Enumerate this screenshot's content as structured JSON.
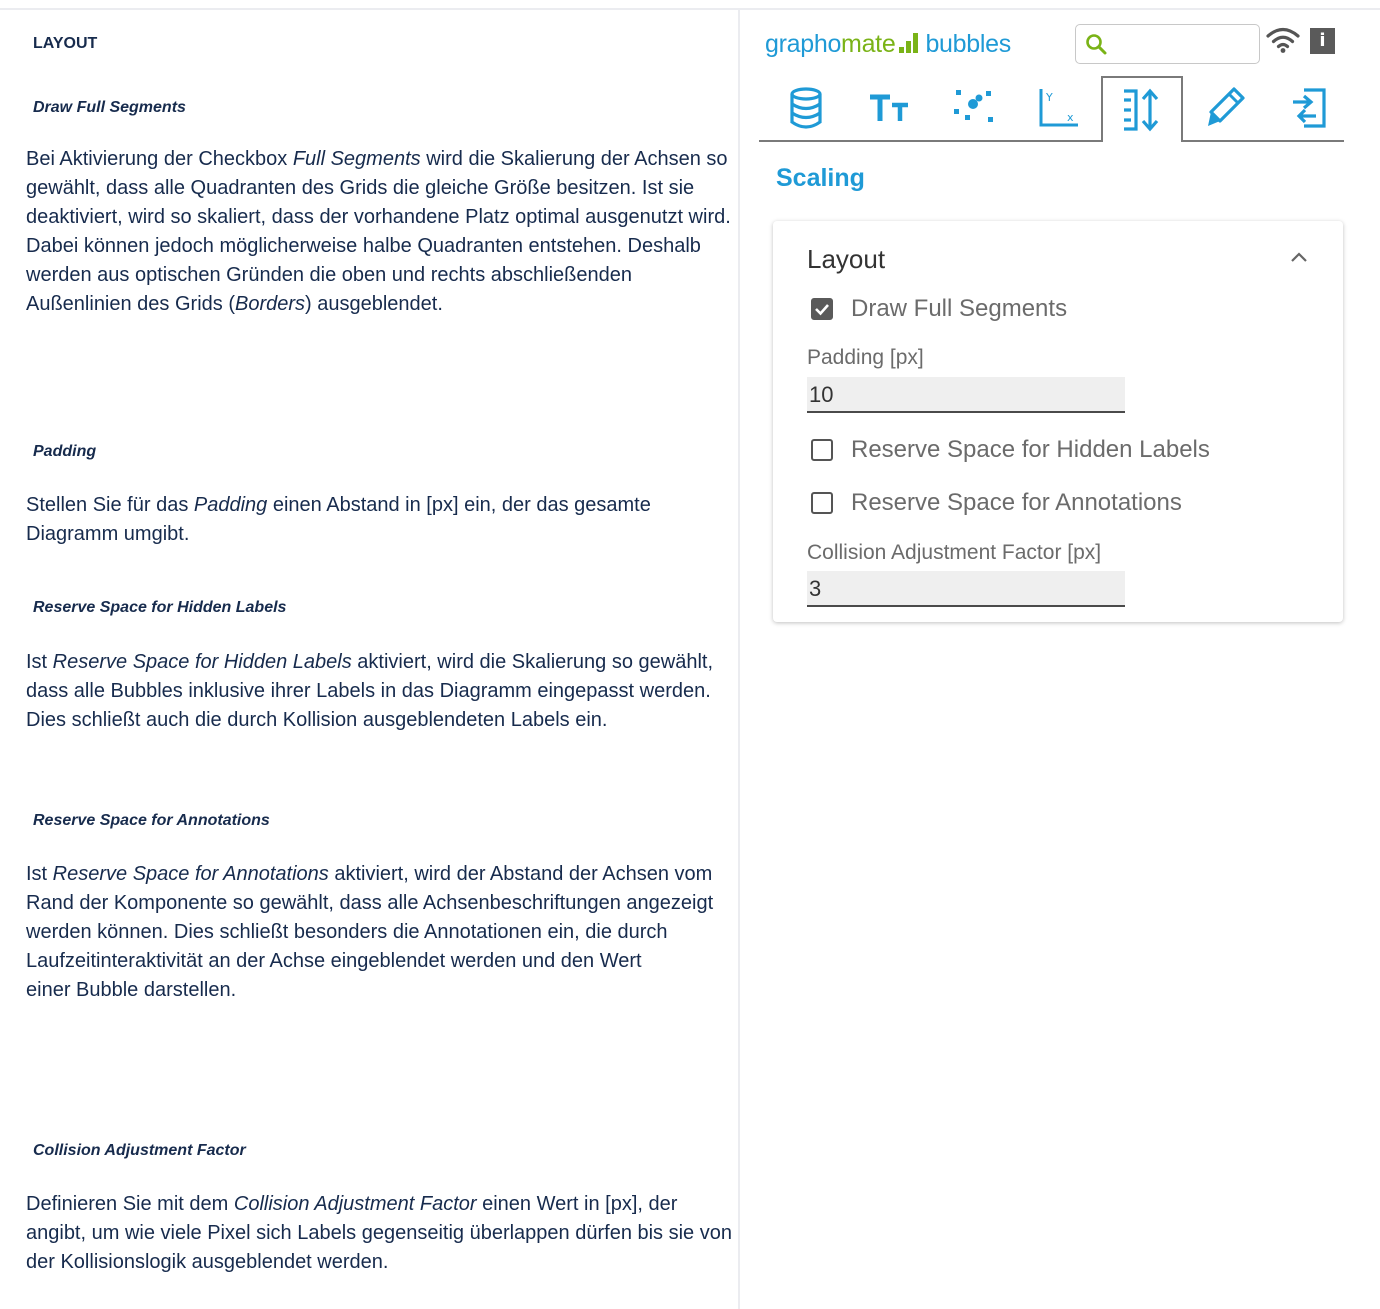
{
  "doc": {
    "heading": "LAYOUT",
    "sections": [
      {
        "title": "Draw Full Segments",
        "text_parts": [
          "Bei Aktivierung der Checkbox ",
          "Full Segments",
          " wird die Skalierung der Achsen so gewählt, dass alle Quadranten des Grids die gleiche Größe besitzen. Ist sie deaktiviert, wird so skaliert, dass der vorhandene Platz optimal ausgenutzt wird. Dabei können jedoch möglicherweise halbe Quadranten entstehen. Deshalb werden aus optischen Gründen die oben und rechts abschließenden Außenlinien des Grids (",
          "Borders",
          ") ausgeblendet."
        ]
      },
      {
        "title": "Padding",
        "text_parts": [
          "Stellen Sie für das ",
          "Padding",
          " einen Abstand in [px] ein, der das gesamte Diagramm umgibt."
        ]
      },
      {
        "title": "Reserve Space for Hidden Labels",
        "text_parts": [
          "Ist ",
          "Reserve Space for Hidden Labels",
          " aktiviert, wird die Skalierung so gewählt, dass alle Bubbles inklusive ihrer Labels in das Diagramm eingepasst werden. Dies schließt auch die durch Kollision ausgeblendeten Labels ein."
        ]
      },
      {
        "title": "Reserve Space for Annotations",
        "text_parts": [
          "Ist ",
          "Reserve Space for Annotations",
          " aktiviert, wird der Abstand der Achsen vom Rand der Komponente so gewählt, dass alle Achsenbeschriftungen angezeigt werden können. Dies schließt besonders die Annotationen ein, die durch Laufzeitinteraktivität an der Achse eingeblendet werden und den Wert",
          "einer Bubble darstellen."
        ]
      },
      {
        "title": "Collision Adjustment Factor",
        "text_parts": [
          "Definieren Sie mit dem ",
          "Collision Adjustment Factor",
          " einen Wert in [px], der angibt, um wie viele Pixel sich Labels gegenseitig überlappen dürfen bis sie von der Kollisionslogik ausgeblendet werden."
        ]
      }
    ]
  },
  "widget": {
    "logo": {
      "part1": "grapho",
      "part2": "mate",
      "part3": "bubbles"
    },
    "colors": {
      "brand_blue": "#1f9ad6",
      "brand_green": "#7ab317"
    },
    "search": {
      "value": "",
      "icon": "search-icon"
    },
    "info_label": "i",
    "tabs": [
      {
        "name": "database-icon",
        "active": false
      },
      {
        "name": "text-size-icon",
        "active": false
      },
      {
        "name": "bubbles-icon",
        "active": false
      },
      {
        "name": "axis-icon",
        "active": false
      },
      {
        "name": "scaling-icon",
        "active": true
      },
      {
        "name": "pencil-icon",
        "active": false
      },
      {
        "name": "export-icon",
        "active": false
      }
    ],
    "section_title": "Scaling",
    "card": {
      "title": "Layout",
      "draw_full_segments": {
        "label": "Draw Full Segments",
        "checked": true
      },
      "padding": {
        "label": "Padding [px]",
        "value": "10"
      },
      "reserve_hidden_labels": {
        "label": "Reserve Space for Hidden Labels",
        "checked": false
      },
      "reserve_annotations": {
        "label": "Reserve Space for Annotations",
        "checked": false
      },
      "collision": {
        "label": "Collision Adjustment Factor [px]",
        "value": "3"
      }
    }
  }
}
